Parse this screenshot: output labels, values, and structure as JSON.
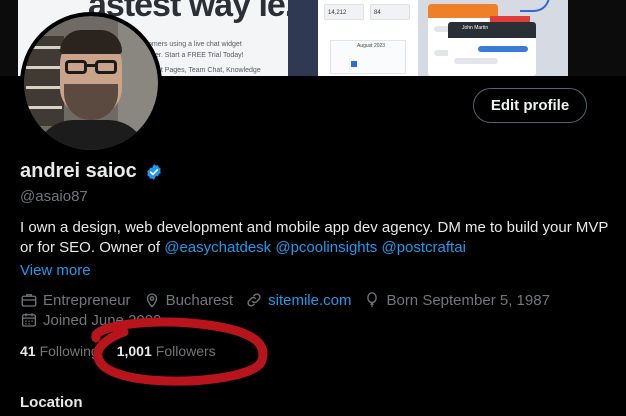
{
  "banner": {
    "headline": "astest way le.",
    "line1": "omers using a live chat widget",
    "line2": "sker. Start a FREE Trial Today!",
    "line3": "Chat Pages, Team Chat, Knowledge",
    "card1_value": "14,212",
    "card2_value": "84",
    "calendar_title": "August 2023",
    "chat_title": "John Martin"
  },
  "profile": {
    "edit_label": "Edit profile",
    "name": "andrei saioc",
    "handle": "@asaio87",
    "bio_text": "I own a design, web development and mobile app dev agency. DM me to build your MVP or for SEO. Owner of",
    "mentions": [
      "@easychatdesk",
      "@pcoolinsights",
      "@postcraftai"
    ],
    "view_more": "View more",
    "profession": "Entrepreneur",
    "location": "Bucharest",
    "website": "sitemile.com",
    "born": "Born September 5, 1987",
    "joined": "Joined June 2009",
    "following_count": "41",
    "following_label": "Following",
    "followers_count": "1,001",
    "followers_label": "Followers"
  },
  "section": {
    "location_heading": "Location"
  },
  "colors": {
    "accent": "#1d9bf0",
    "muted": "#71767b",
    "annotation": "#b8141c"
  },
  "icons": {
    "verified": "verified-badge-icon",
    "profession": "briefcase-icon",
    "location": "map-pin-icon",
    "website": "link-icon",
    "born": "balloon-icon",
    "joined": "calendar-icon"
  }
}
